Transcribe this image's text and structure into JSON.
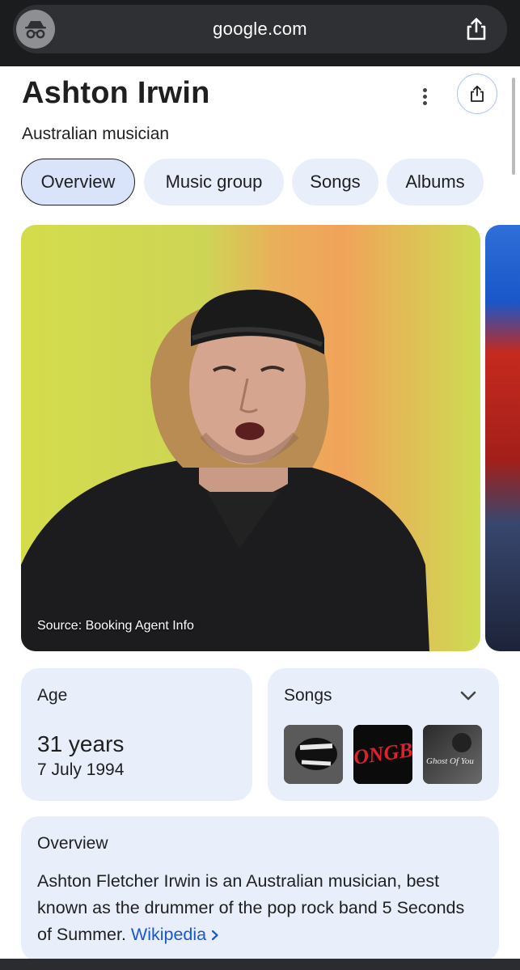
{
  "browser": {
    "url": "google.com",
    "incognito_icon": "incognito-icon",
    "share_icon": "share-icon"
  },
  "entity": {
    "name": "Ashton Irwin",
    "description": "Australian musician",
    "more_icon": "more-vert-icon",
    "share_icon": "share-icon"
  },
  "tabs": [
    {
      "label": "Overview",
      "active": true
    },
    {
      "label": "Music group",
      "active": false
    },
    {
      "label": "Songs",
      "active": false
    },
    {
      "label": "Albums",
      "active": false
    }
  ],
  "image": {
    "source_label": "Source: Booking Agent Info"
  },
  "age_card": {
    "label": "Age",
    "value": "31 years",
    "birth_date": "7 July 1994"
  },
  "songs_card": {
    "label": "Songs",
    "expand_icon": "chevron-down-icon",
    "thumbnails": [
      {
        "art_text": ""
      },
      {
        "art_text": "ONGBL"
      },
      {
        "art_text": "Ghost Of You"
      }
    ]
  },
  "overview_card": {
    "label": "Overview",
    "text": "Ashton Fletcher Irwin is an Australian musician, best known as the drummer of the pop rock band 5 Seconds of Summer.",
    "link_label": "Wikipedia",
    "link_icon": "chevron-right-icon"
  },
  "colors": {
    "accent": "#1a56d1",
    "card_bg": "#e8effb",
    "chip_active_bg": "#d9e4fb",
    "topbar_bg": "#1b1c1e"
  }
}
